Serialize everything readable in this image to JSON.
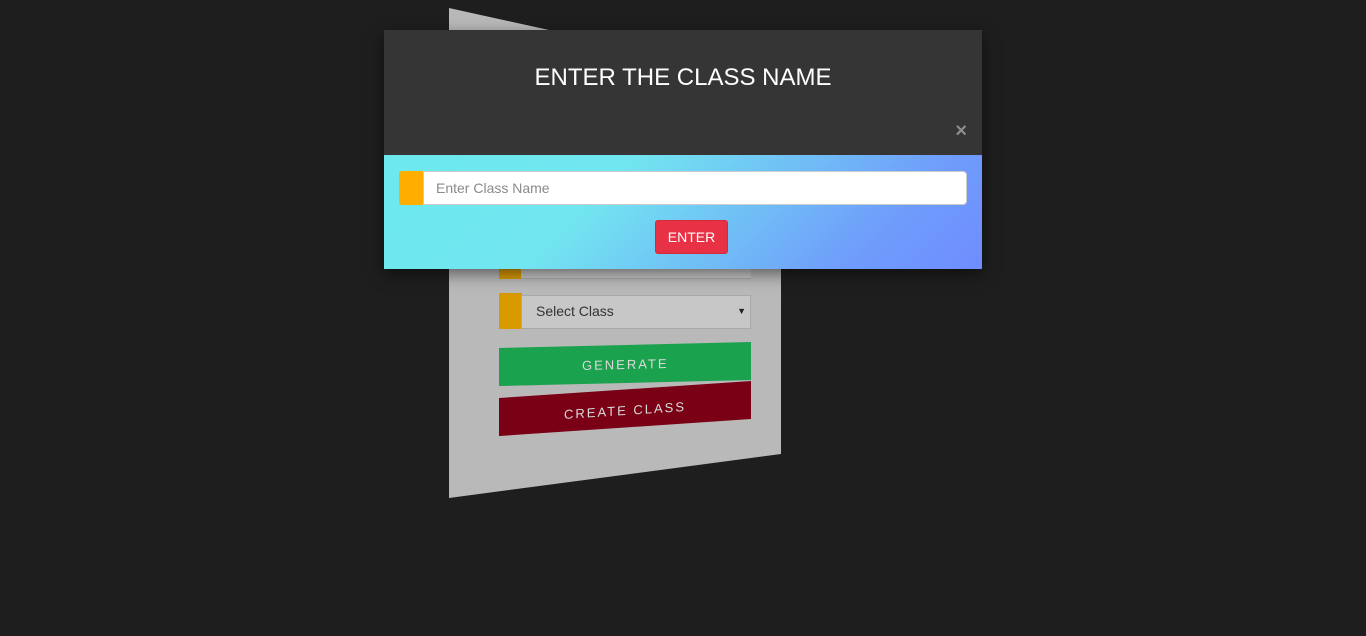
{
  "modal": {
    "title": "ENTER THE CLASS NAME",
    "close_symbol": "×",
    "input": {
      "value": "",
      "placeholder": "Enter Class Name"
    },
    "enter_label": "ENTER"
  },
  "background_card": {
    "select_class": {
      "selected": "Select Class"
    },
    "generate_label": "GENERATE",
    "create_class_label": "CREATE CLASS"
  },
  "colors": {
    "page_background": "#1e1e1e",
    "modal_header": "#353535",
    "accent_addon": "#ffae00",
    "enter_button": "#e83145",
    "generate_button": "#1ba24f",
    "create_class_button": "#7a0015"
  },
  "icons": {
    "close": "close-icon",
    "dropdown": "caret-down-icon"
  }
}
